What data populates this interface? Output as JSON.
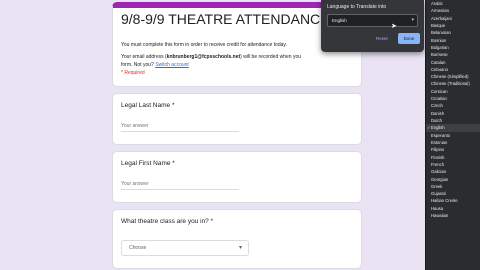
{
  "form": {
    "title": "9/8-9/9 THEATRE ATTENDANCE",
    "description_line1": "You must complete this form in order to receive credit for attendance today.",
    "email_prefix": "Your email address (",
    "email": "knbrunberg1@fcpsschools.net",
    "email_suffix": ") will be recorded when you",
    "submit_prefix": "form. Not you?",
    "switch_account": "Switch account",
    "required_note": "* Required"
  },
  "questions": [
    {
      "label": "Legal Last Name *",
      "placeholder": "Your answer"
    },
    {
      "label": "Legal First Name *",
      "placeholder": "Your answer"
    },
    {
      "label": "What theatre class are you in? *",
      "select_value": "Choose"
    }
  ],
  "translate_popup": {
    "title": "Language to Translate into",
    "selected_language": "English",
    "reset_label": "Reset",
    "done_label": "Done"
  },
  "language_list": [
    "Arabic",
    "Armenian",
    "Azerbaijani",
    "Basque",
    "Belarusian",
    "Bosnian",
    "Bulgarian",
    "Burmese",
    "Catalan",
    "Cebuano",
    "Chinese (Simplified)",
    "Chinese (Traditional)",
    "Corsican",
    "Croatian",
    "Czech",
    "Danish",
    "Dutch",
    "English",
    "Esperanto",
    "Estonian",
    "Filipino",
    "Finnish",
    "French",
    "Galician",
    "Georgian",
    "Greek",
    "Gujarati",
    "Haitian Creole",
    "Hausa",
    "Hawaiian"
  ],
  "colors": {
    "accent": "#9c27b0",
    "background": "#e9e3f4",
    "required": "#d93025",
    "link": "#1a73e8"
  }
}
